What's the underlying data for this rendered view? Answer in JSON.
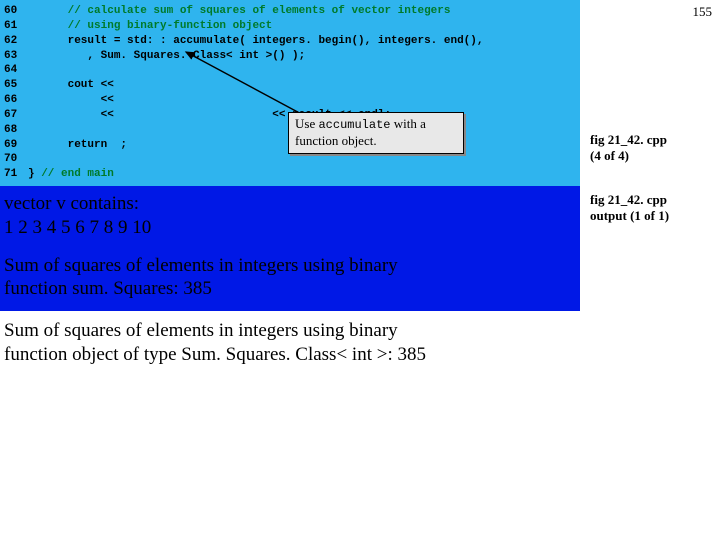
{
  "page_number": "155",
  "code": {
    "lines": [
      {
        "num": "60",
        "indent": "      ",
        "text": "// calculate sum of squares of elements of vector integers",
        "cls": "comment"
      },
      {
        "num": "61",
        "indent": "      ",
        "text": "// using binary-function object",
        "cls": "comment"
      },
      {
        "num": "62",
        "indent": "      ",
        "text": "result = std: : accumulate( integers. begin(), integers. end(),",
        "cls": ""
      },
      {
        "num": "63",
        "indent": "         ",
        "text": ", Sum. Squares. Class< int >() );",
        "cls": ""
      },
      {
        "num": "64",
        "indent": "",
        "text": "",
        "cls": ""
      },
      {
        "num": "65",
        "indent": "      ",
        "text": "cout <<",
        "cls": ""
      },
      {
        "num": "66",
        "indent": "           ",
        "text": "<<",
        "cls": ""
      },
      {
        "num": "67",
        "indent": "           ",
        "text": "<<",
        "tail": "                        << result << endl;",
        "cls": ""
      },
      {
        "num": "68",
        "indent": "",
        "text": "",
        "cls": ""
      },
      {
        "num": "69",
        "indent": "      ",
        "text": "return  ;",
        "cls": ""
      },
      {
        "num": "70",
        "indent": "",
        "text": "",
        "cls": ""
      },
      {
        "num": "71",
        "indent": "",
        "text": "} ",
        "tail_comment": "// end main",
        "cls": ""
      }
    ]
  },
  "callout": {
    "text_before": "Use ",
    "mono": "accumulate",
    "text_after": " with a function object."
  },
  "captions": {
    "cap1_line1": "fig 21_42. cpp",
    "cap1_line2": "(4 of 4)",
    "cap2_line1": "fig 21_42. cpp",
    "cap2_line2": "output (1 of 1)"
  },
  "output": {
    "blue_block1_line1": "vector v contains:",
    "blue_block1_line2": "1 2 3 4 5 6 7 8 9 10",
    "blue_block2_line1": "Sum of squares of elements in integers using binary",
    "blue_block2_line2": "function sum. Squares: 385",
    "white_line1": "Sum of squares of elements in integers using binary",
    "white_line2": "function object of type Sum. Squares. Class< int >: 385"
  }
}
